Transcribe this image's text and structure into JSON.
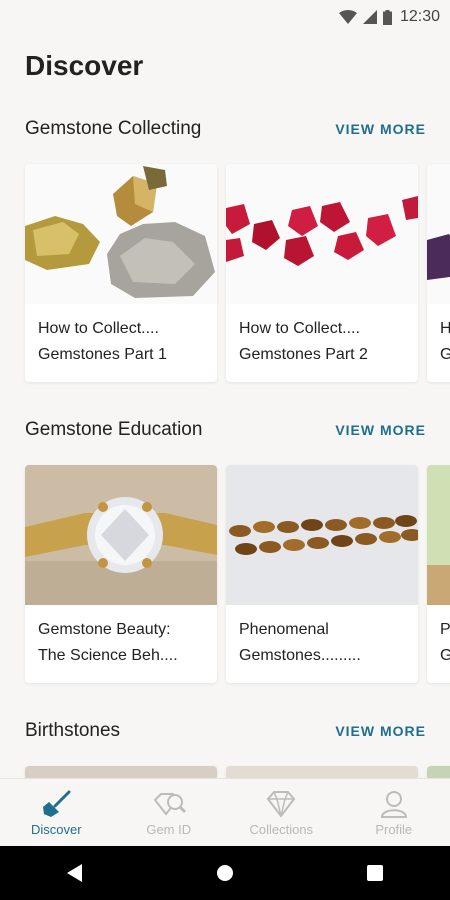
{
  "status": {
    "time": "12:30"
  },
  "page": {
    "title": "Discover"
  },
  "sections": [
    {
      "title": "Gemstone Collecting",
      "view_more": "VIEW MORE",
      "cards": [
        {
          "text": "How to Collect....\nGemstones Part 1",
          "image": "pyrite-specimen"
        },
        {
          "text": "How to Collect....\nGemstones Part 2",
          "image": "red-spinel-crystals"
        },
        {
          "text": "H\nG",
          "image": "purple-crystal"
        }
      ]
    },
    {
      "title": "Gemstone Education",
      "view_more": "VIEW MORE",
      "cards": [
        {
          "text": "Gemstone Beauty:\nThe Science Beh....",
          "image": "diamond-ring"
        },
        {
          "text": "Phenomenal\nGemstones.........",
          "image": "tigers-eye-beads"
        },
        {
          "text": "P\nG",
          "image": "green-gem"
        }
      ]
    },
    {
      "title": "Birthstones",
      "view_more": "VIEW MORE"
    }
  ],
  "bottom_nav": [
    {
      "label": "Discover",
      "icon": "shovel-icon",
      "active": true
    },
    {
      "label": "Gem ID",
      "icon": "gem-search-icon",
      "active": false
    },
    {
      "label": "Collections",
      "icon": "diamond-icon",
      "active": false
    },
    {
      "label": "Profile",
      "icon": "profile-icon",
      "active": false
    }
  ],
  "colors": {
    "accent": "#1e6f8f",
    "background": "#f7f6f4"
  }
}
